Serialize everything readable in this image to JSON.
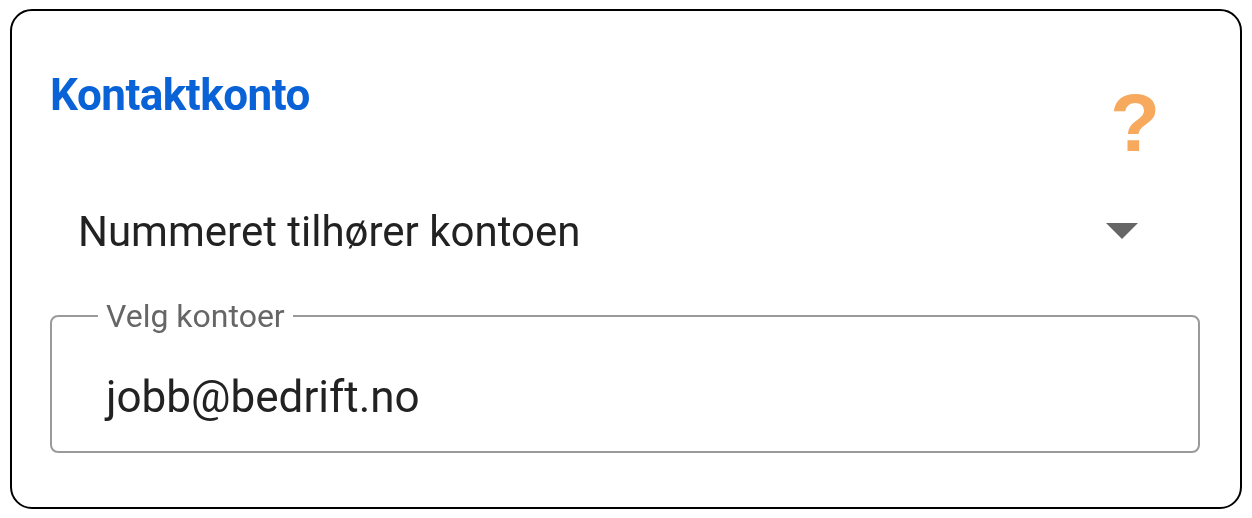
{
  "card": {
    "title": "Kontaktkonto",
    "help": "?"
  },
  "dropdown": {
    "value": "Nummeret tilhører kontoen"
  },
  "account_field": {
    "label": "Velg kontoer",
    "value": "jobb@bedrift.no"
  }
}
